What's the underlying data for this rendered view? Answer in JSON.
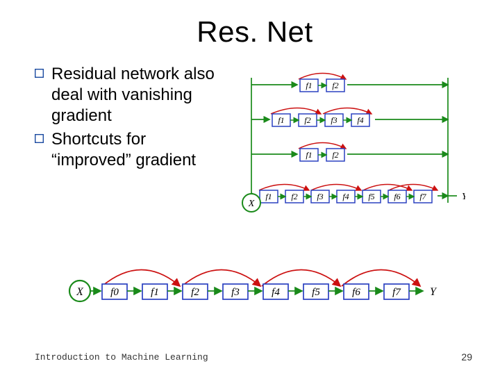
{
  "title": "Res. Net",
  "bullets": [
    "Residual network also deal with vanishing gradient",
    "Shortcuts for “improved” gradient"
  ],
  "diagram_top": {
    "rows": [
      [
        "f1",
        "f2"
      ],
      [
        "f1",
        "f2",
        "f3",
        "f4"
      ],
      [
        "f1",
        "f2"
      ],
      [
        "f1",
        "f2",
        "f3",
        "f4",
        "f5",
        "f6",
        "f7"
      ]
    ],
    "input_label": "X",
    "output_label": "Y"
  },
  "diagram_bottom": {
    "input_label": "X",
    "nodes": [
      "f0",
      "f1",
      "f2",
      "f3",
      "f4",
      "f5",
      "f6",
      "f7"
    ],
    "output_label": "Y"
  },
  "footer_text": "Introduction to Machine Learning",
  "page_number": "29"
}
